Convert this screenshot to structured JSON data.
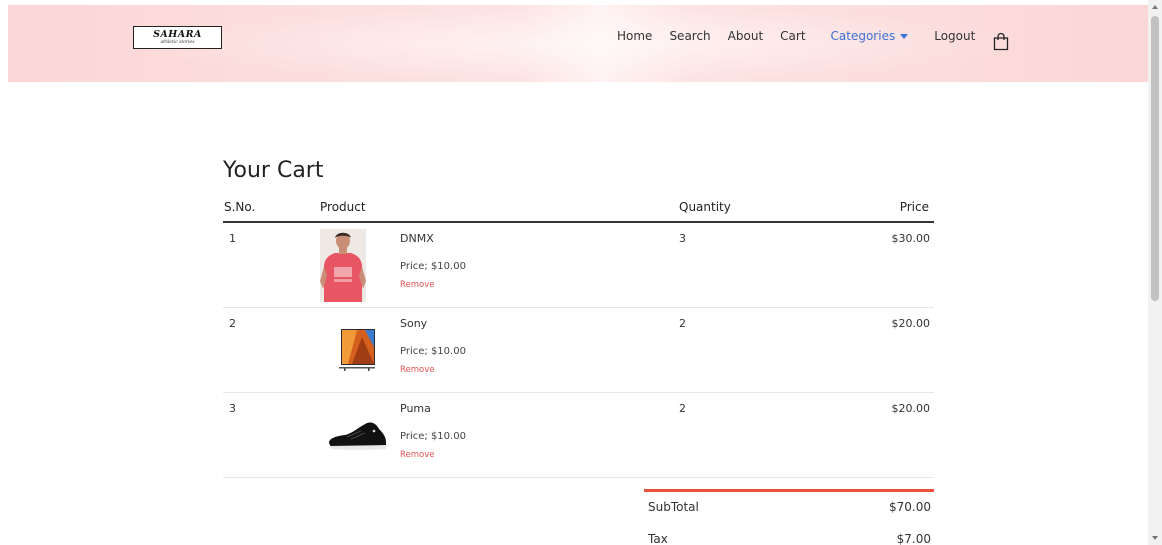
{
  "brand": {
    "name": "SAHARA",
    "tagline": "athletic stories"
  },
  "nav": {
    "links": [
      "Home",
      "Search",
      "About",
      "Cart"
    ],
    "categories_label": "Categories",
    "logout_label": "Logout"
  },
  "cart": {
    "title": "Your Cart",
    "headers": {
      "sno": "S.No.",
      "product": "Product",
      "quantity": "Quantity",
      "price": "Price"
    },
    "remove_label": "Remove",
    "items": [
      {
        "sno": "1",
        "name": "DNMX",
        "unit_price": "Price; $10.00",
        "quantity": "3",
        "price": "$30.00",
        "image": "red-tshirt"
      },
      {
        "sno": "2",
        "name": "Sony",
        "unit_price": "Price; $10.00",
        "quantity": "2",
        "price": "$20.00",
        "image": "television"
      },
      {
        "sno": "3",
        "name": "Puma",
        "unit_price": "Price; $10.00",
        "quantity": "2",
        "price": "$20.00",
        "image": "black-sneaker"
      }
    ],
    "summary": {
      "subtotal_label": "SubTotal",
      "subtotal_value": "$70.00",
      "tax_label": "Tax",
      "tax_value": "$7.00"
    }
  },
  "colors": {
    "accent_link": "#3b6fd4",
    "remove": "#e05252",
    "summary_line": "#e8533a",
    "navbar_bg": "#fbd6d6"
  },
  "icons": {
    "bag": "shopping-bag-icon",
    "dropdown": "caret-down-icon"
  }
}
